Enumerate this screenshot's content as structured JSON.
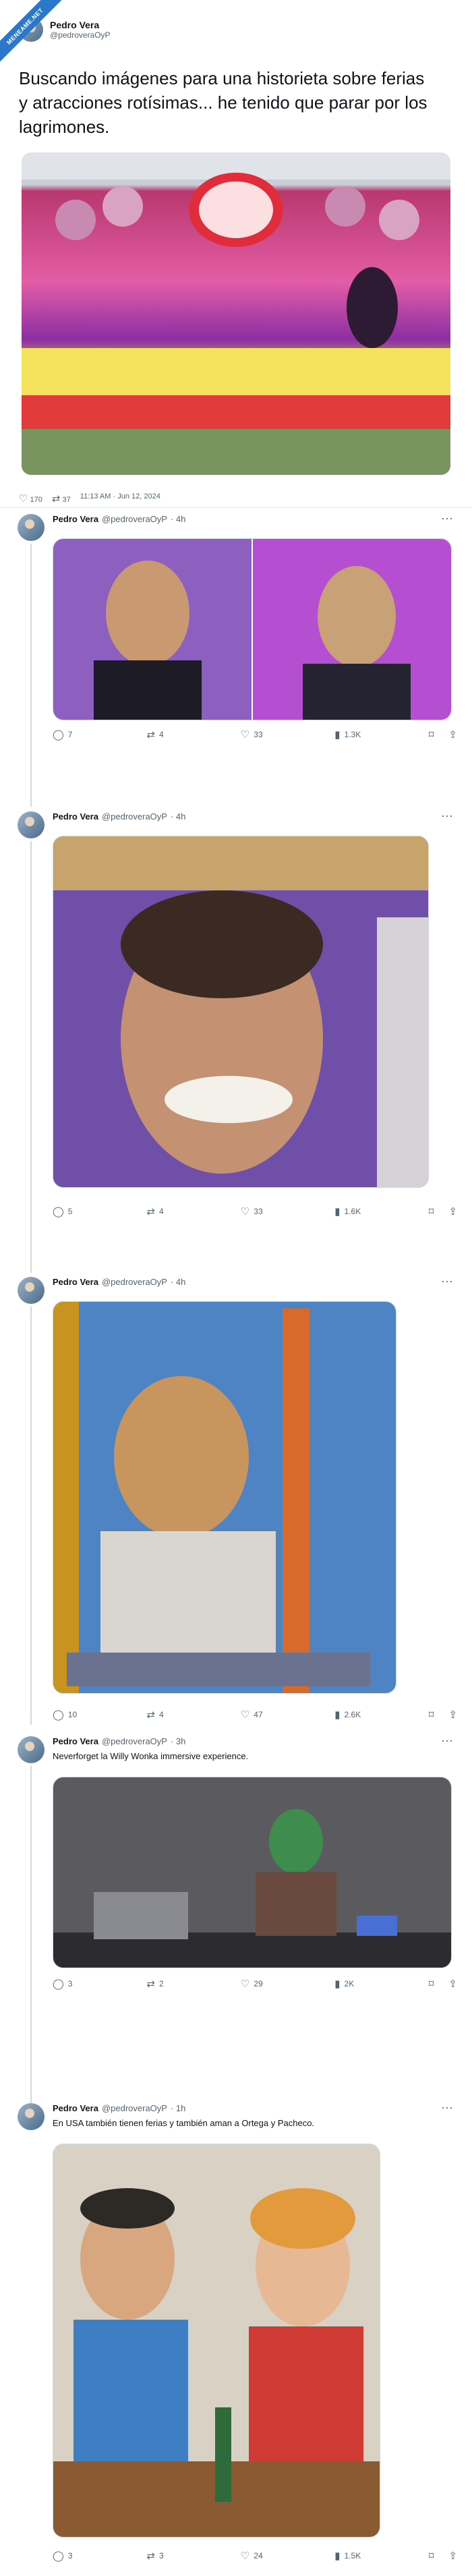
{
  "badge": {
    "text": "MENEAME.NET"
  },
  "main": {
    "name": "Pedro Vera",
    "handle": "@pedroveraOyP",
    "text": "Buscando imágenes para una historieta sobre ferias y atracciones rotísimas... he tenido que parar por los lagrimones.",
    "meta": {
      "likes": "170",
      "retweets": "37",
      "time": "11:13 AM · Jun 12, 2024"
    }
  },
  "replies": [
    {
      "name": "Pedro Vera",
      "handle": "@pedroveraOyP",
      "time": "· 4h",
      "text": "",
      "comments": "7",
      "retweets": "4",
      "likes": "33",
      "views": "1.3K"
    },
    {
      "name": "Pedro Vera",
      "handle": "@pedroveraOyP",
      "time": "· 4h",
      "text": "",
      "comments": "5",
      "retweets": "4",
      "likes": "33",
      "views": "1.6K"
    },
    {
      "name": "Pedro Vera",
      "handle": "@pedroveraOyP",
      "time": "· 4h",
      "text": "",
      "comments": "10",
      "retweets": "4",
      "likes": "47",
      "views": "2.6K"
    },
    {
      "name": "Pedro Vera",
      "handle": "@pedroveraOyP",
      "time": "· 3h",
      "text": "Neverforget la Willy Wonka immersive experience.",
      "comments": "3",
      "retweets": "2",
      "likes": "29",
      "views": "2K"
    },
    {
      "name": "Pedro Vera",
      "handle": "@pedroveraOyP",
      "time": "· 1h",
      "text": "En USA también tienen ferias y también aman a Ortega y Pacheco.",
      "comments": "3",
      "retweets": "3",
      "likes": "24",
      "views": "1.5K"
    }
  ],
  "icons": {
    "comment": "comment-icon",
    "retweet": "retweet-icon",
    "like": "heart-icon",
    "views": "views-icon",
    "bookmark": "bookmark-icon",
    "share": "share-icon",
    "more": "more-icon"
  },
  "colors": {
    "accent": "#1d9bf0",
    "badge": "#2b77c8",
    "muted": "#536471"
  }
}
